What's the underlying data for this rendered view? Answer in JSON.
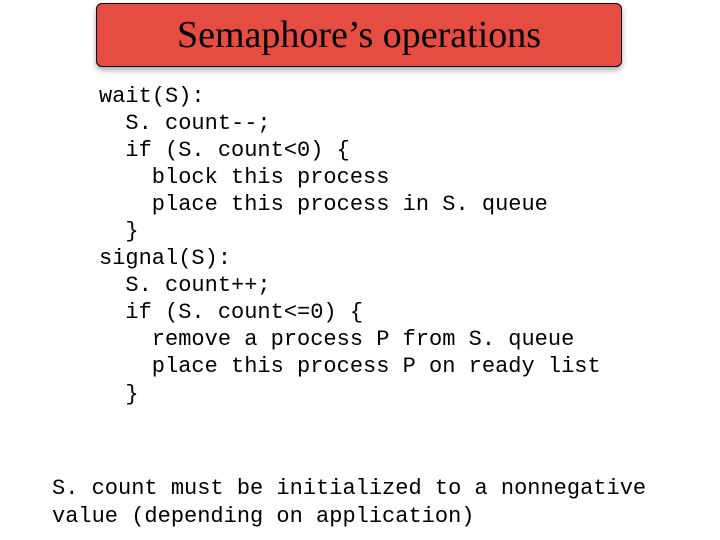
{
  "title": "Semaphore’s operations",
  "code": "wait(S):\n  S. count--;\n  if (S. count<0) {\n    block this process\n    place this process in S. queue\n  }\nsignal(S):\n  S. count++;\n  if (S. count<=0) {\n    remove a process P from S. queue\n    place this process P on ready list\n  }",
  "footer": "S. count must be initialized to a nonnegative\nvalue (depending on application)"
}
